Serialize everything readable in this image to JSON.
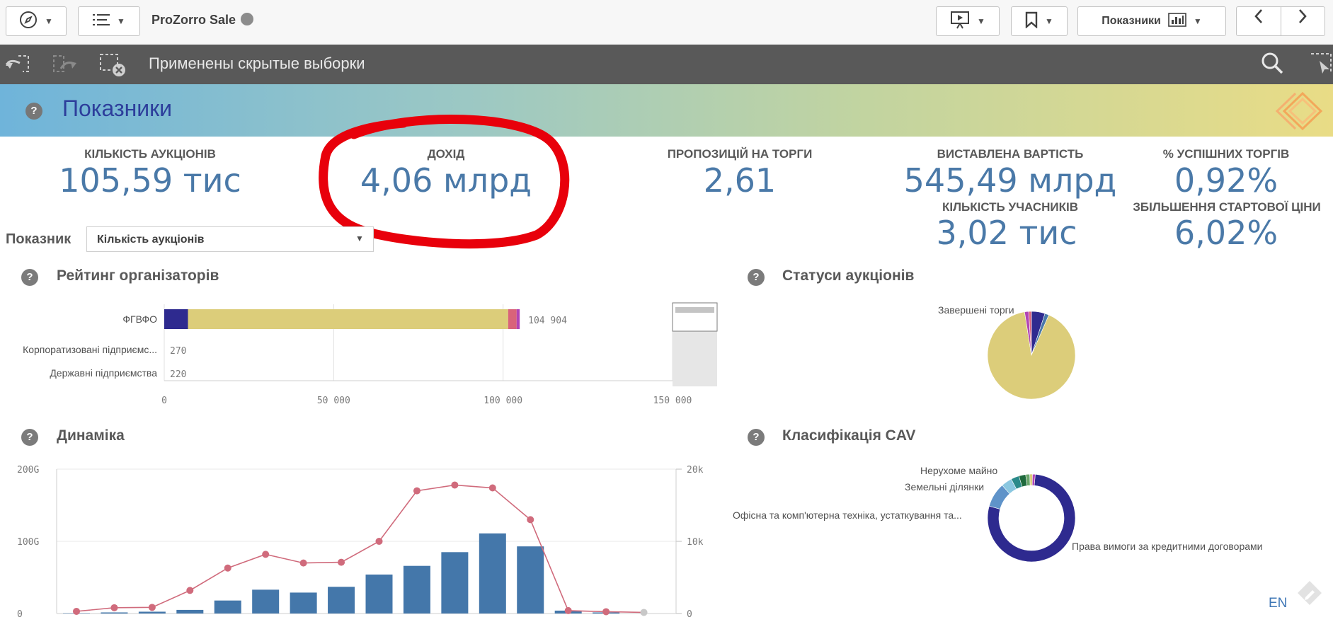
{
  "toolbar": {
    "app_title": "ProZorro Sale",
    "sheet_button_label": "Показники"
  },
  "selection_bar": {
    "text": "Применены скрытые выборки"
  },
  "sheet": {
    "title": "Показники"
  },
  "kpis": [
    {
      "label": "КІЛЬКІСТЬ АУКЦІОНІВ",
      "value": "105,59 тис"
    },
    {
      "label": "ДОХІД",
      "value": "4,06 млрд"
    },
    {
      "label": "ПРОПОЗИЦІЙ НА ТОРГИ",
      "value": "2,61"
    },
    {
      "label": "ВИСТАВЛЕНА ВАРТІСТЬ",
      "value": "545,49 млрд"
    },
    {
      "label": "% УСПІШНИХ ТОРГІВ",
      "value": "0,92%"
    },
    {
      "label": "КІЛЬКІСТЬ УЧАСНИКІВ",
      "value": "3,02 тис"
    },
    {
      "label": "ЗБІЛЬШЕННЯ СТАРТОВОЇ ЦІНИ",
      "value": "6,02%"
    }
  ],
  "metric_selector": {
    "label": "Показник",
    "selected": "Кількість аукціонів"
  },
  "annotation": {
    "color": "#e8000b",
    "highlighted_kpi": "ДОХІД"
  },
  "colors": {
    "accent": "#4a79a8",
    "navy": "#2e2a8f",
    "sand": "#dccd7a",
    "pink": "#d9637a",
    "magenta": "#b144b5",
    "bar_blue": "#4477aa",
    "line_red": "#d06b7c"
  },
  "chart_data": [
    {
      "type": "bar",
      "title": "Рейтинг організаторів",
      "orientation": "horizontal",
      "stacked": true,
      "categories": [
        "ФГВФО",
        "Корпоратизовані підприємс...",
        "Державні підприємства"
      ],
      "series": [
        {
          "values": [
            7000,
            0,
            0
          ]
        },
        {
          "values": [
            94500,
            270,
            220
          ]
        },
        {
          "values": [
            2500,
            0,
            0
          ]
        },
        {
          "values": [
            904,
            0,
            0
          ]
        }
      ],
      "data_labels": [
        "104 904",
        "270",
        "220"
      ],
      "xticks": [
        "0",
        "50 000",
        "100 000",
        "150 000"
      ],
      "xlim": [
        0,
        150000
      ]
    },
    {
      "type": "pie",
      "title": "Статуси аукціонів",
      "slice_labels": [
        "Завершені торги"
      ],
      "slices": [
        {
          "value": 91,
          "color": "#dccd7a"
        },
        {
          "value": 5,
          "color": "#2e2a8f"
        },
        {
          "value": 1.5,
          "color": "#4a79a8"
        },
        {
          "value": 1.5,
          "color": "#b144b5"
        },
        {
          "value": 1,
          "color": "#d9637a"
        }
      ]
    },
    {
      "type": "bar",
      "title": "Динаміка",
      "combo": true,
      "y_left_ticks": [
        "200G",
        "100G",
        "0"
      ],
      "y_right_ticks": [
        "20k",
        "10k",
        "0"
      ],
      "ylim_left": [
        0,
        200
      ],
      "ylim_right": [
        0,
        20000
      ],
      "series": [
        {
          "type": "bar",
          "axis": "left",
          "values": [
            0.5,
            1.5,
            2.5,
            5,
            18,
            33,
            29,
            37,
            54,
            66,
            85,
            111,
            93,
            4,
            1.5,
            0
          ]
        },
        {
          "type": "line",
          "axis": "right",
          "values": [
            300,
            800,
            850,
            3200,
            6300,
            8200,
            7000,
            7100,
            10000,
            17000,
            17800,
            17400,
            13000,
            400,
            250,
            150
          ]
        }
      ]
    },
    {
      "type": "pie",
      "title": "Класифікація CAV",
      "donut": true,
      "slice_labels": [
        "Нерухоме майно",
        "Земельні ділянки",
        "Офісна та комп'ютерна техніка, устаткування та...",
        "Права вимоги за кредитними договорами"
      ],
      "slices": [
        {
          "value": 78,
          "color": "#2e2a8f"
        },
        {
          "value": 9,
          "color": "#5f93c9"
        },
        {
          "value": 4,
          "color": "#8ac7e0"
        },
        {
          "value": 3,
          "color": "#2a8a8a"
        },
        {
          "value": 2.5,
          "color": "#1f6a3d"
        },
        {
          "value": 1.5,
          "color": "#6aa66a"
        },
        {
          "value": 1,
          "color": "#dccd7a"
        },
        {
          "value": 1,
          "color": "#b144b5"
        }
      ]
    }
  ],
  "footer": {
    "language": "EN"
  }
}
